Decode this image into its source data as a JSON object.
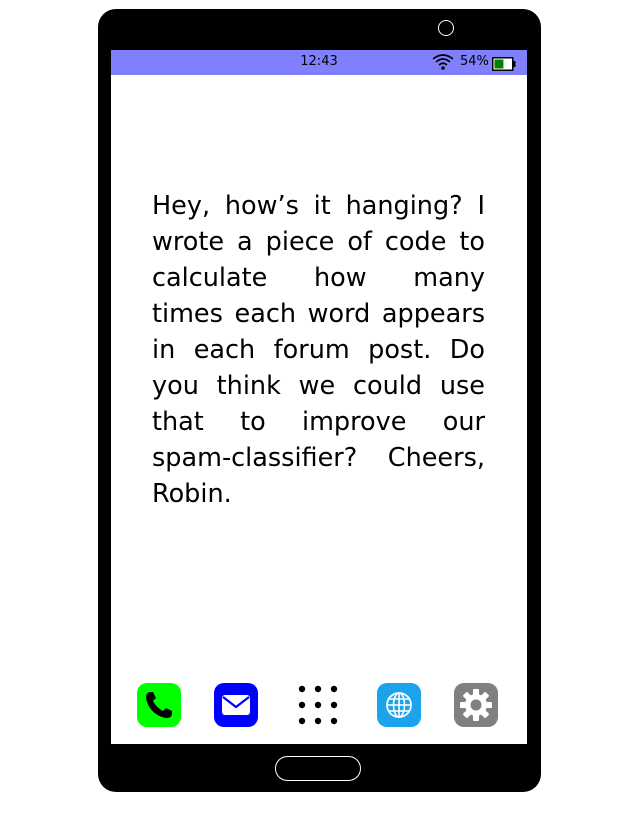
{
  "status_bar": {
    "time": "12:43",
    "battery_percent": "54%",
    "battery_level": 0.54,
    "background_color": "#8080ff",
    "icons": [
      "wifi-icon",
      "battery-icon"
    ]
  },
  "message": {
    "text": "Hey, how’s it hanging?  I wrote a piece of code to calculate how many times each word appears in each forum post.  Do you think we could use that to im­prove our spam-classifier? Cheers, Robin."
  },
  "dock": {
    "apps": [
      {
        "name": "phone",
        "icon": "phone-icon",
        "color": "#00ff00"
      },
      {
        "name": "mail",
        "icon": "mail-icon",
        "color": "#0000ff"
      },
      {
        "name": "apps",
        "icon": "app-grid-icon",
        "color": "#000000"
      },
      {
        "name": "browser",
        "icon": "globe-icon",
        "color": "#1ca3ec"
      },
      {
        "name": "settings",
        "icon": "gear-icon",
        "color": "#808080"
      }
    ]
  }
}
